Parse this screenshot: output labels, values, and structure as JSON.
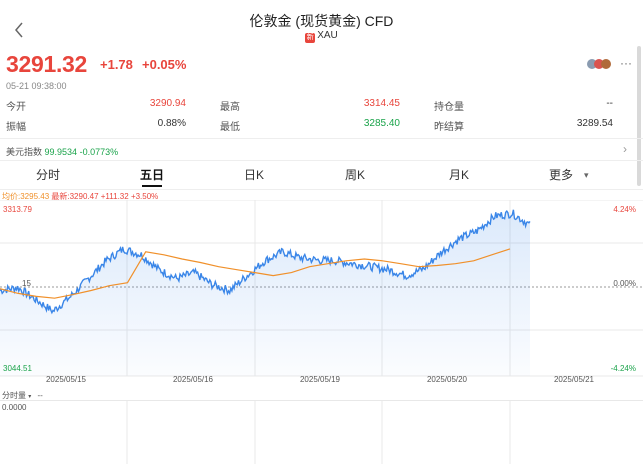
{
  "header": {
    "title": "伦敦金 (现货黄金) CFD",
    "flag_glyph": "新",
    "symbol": "XAU"
  },
  "quote": {
    "price": "3291.32",
    "change": "+1.78",
    "change_pct": "+0.05%",
    "timestamp": "05-21 09:38:00"
  },
  "stats": {
    "open_label": "今开",
    "open": "3290.94",
    "high_label": "最高",
    "high": "3314.45",
    "oi_label": "持仓量",
    "oi": "--",
    "amp_label": "振幅",
    "amp": "0.88%",
    "low_label": "最低",
    "low": "3285.40",
    "prev_label": "昨结算",
    "prev": "3289.54"
  },
  "usd_index": {
    "label": "美元指数",
    "value": "99.9534",
    "change_pct": "-0.0773%"
  },
  "tabs": [
    "分时",
    "五日",
    "日K",
    "周K",
    "月K",
    "更多"
  ],
  "active_tab": "五日",
  "legend": {
    "avg": "均价:3295.43",
    "latest": "最新:3290.47",
    "chg": "+111.32",
    "chg_pct": "+3.50%"
  },
  "chart_data": {
    "type": "line",
    "y_top_label": "3313.79",
    "y_mid_label": "15",
    "y_bottom_label": "3044.51",
    "right_top_label": "4.24%",
    "right_mid_label": "0.00%",
    "right_bottom_label": "-4.24%",
    "x_labels": [
      "2025/05/15",
      "2025/05/16",
      "2025/05/19",
      "2025/05/20",
      "2025/05/21"
    ],
    "ylim": [
      3044.51,
      3313.79
    ],
    "series": [
      {
        "values": [
          3175,
          3180,
          3160,
          3140,
          3165,
          3195,
          3225,
          3245,
          3235,
          3210,
          3195,
          3205,
          3185,
          3175,
          3200,
          3225,
          3240,
          3230,
          3226,
          3225,
          3220,
          3215,
          3210,
          3200,
          3212,
          3240,
          3262,
          3275,
          3300,
          3305,
          3285
        ]
      },
      {
        "values": [
          3178,
          3170,
          3165,
          3162,
          3168,
          3175,
          3183,
          3188,
          3240,
          3235,
          3228,
          3222,
          3215,
          3210,
          3205,
          3200,
          3205,
          3215,
          3220,
          3225,
          3228,
          3225,
          3220,
          3215,
          3217,
          3220,
          3225,
          3235,
          3245
        ]
      }
    ],
    "colors": {
      "price": "#3a86e8",
      "avg": "#f0902a",
      "grid": "#e8e8e8",
      "zero_line": "#999999"
    }
  },
  "volume": {
    "label": "分时量",
    "dash": "--",
    "value": "0.0000"
  }
}
